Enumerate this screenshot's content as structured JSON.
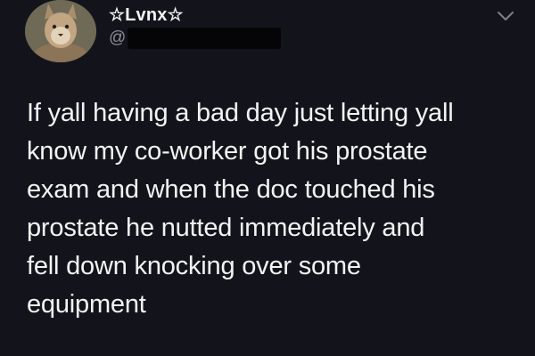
{
  "tweet": {
    "display_name": "☆Lvnx☆",
    "handle_prefix": "@",
    "text": "If yall having a bad day just letting yall\nknow my co-worker got his prostate\nexam and when the doc touched his\nprostate he nutted immediately and\nfell down knocking over some\nequipment"
  },
  "icons": {
    "avatar": "lynx-avatar",
    "menu": "chevron-down-icon"
  },
  "colors": {
    "background": "#13141b",
    "text": "#f3f3f3",
    "muted": "#8b8e96"
  }
}
